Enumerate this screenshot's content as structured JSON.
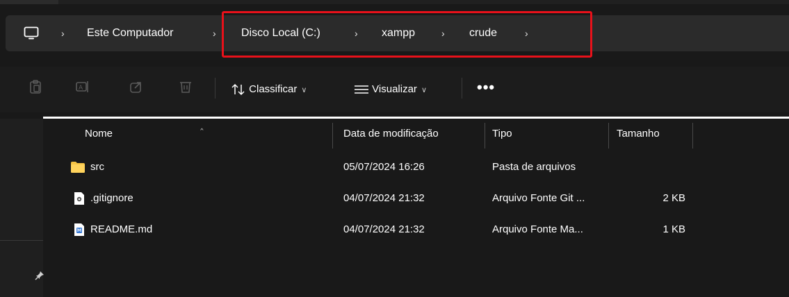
{
  "breadcrumb": {
    "items": [
      "Este Computador",
      "Disco Local (C:)",
      "xampp",
      "crude"
    ]
  },
  "toolbar": {
    "sort_label": "Classificar",
    "view_label": "Visualizar",
    "more_label": "•••"
  },
  "columns": {
    "name": "Nome",
    "modified": "Data de modificação",
    "type": "Tipo",
    "size": "Tamanho"
  },
  "files": [
    {
      "name": "src",
      "modified": "05/07/2024 16:26",
      "type": "Pasta de arquivos",
      "size": "",
      "icon": "folder-icon"
    },
    {
      "name": ".gitignore",
      "modified": "04/07/2024 21:32",
      "type": "Arquivo Fonte Git ...",
      "size": "2 KB",
      "icon": "gitignore-file-icon"
    },
    {
      "name": "README.md",
      "modified": "04/07/2024 21:32",
      "type": "Arquivo Fonte Ma...",
      "size": "1 KB",
      "icon": "markdown-file-icon"
    }
  ],
  "colors": {
    "highlight": "#e8111a",
    "folder": "#f6c445",
    "background": "#191919"
  }
}
